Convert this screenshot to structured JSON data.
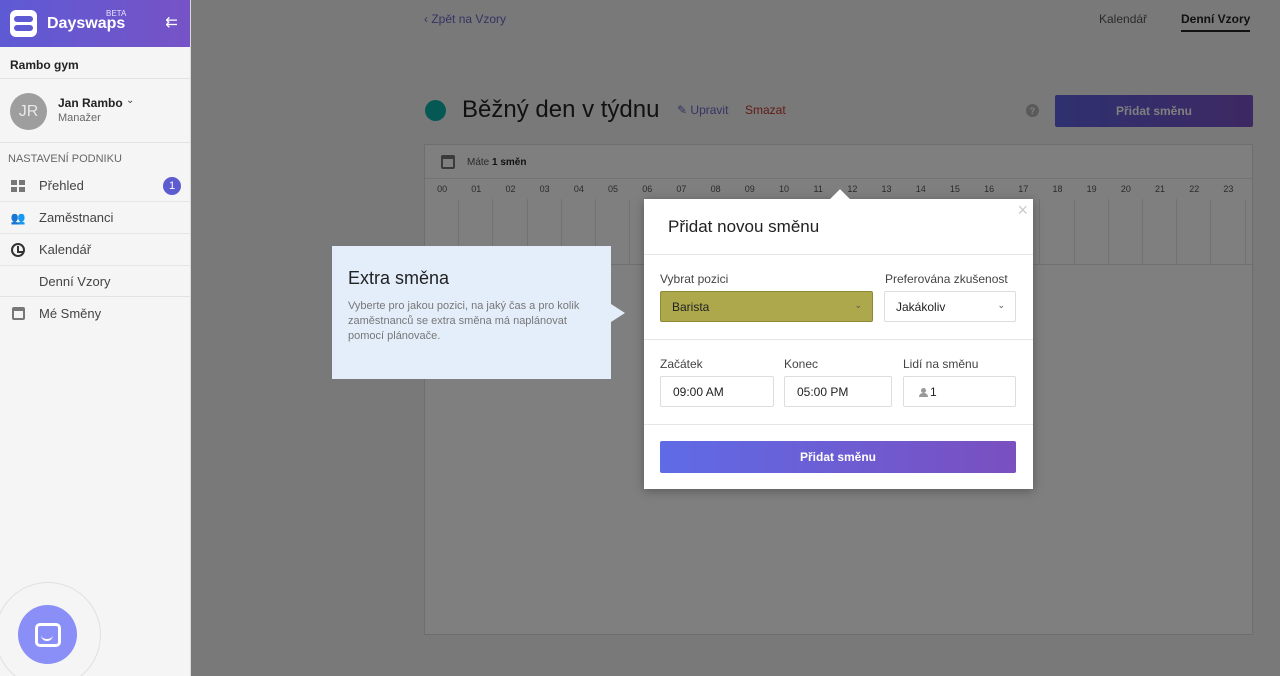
{
  "brand": {
    "name": "Dayswaps",
    "beta": "BETA",
    "collapse_icon": "collapse-icon"
  },
  "company": "Rambo gym",
  "user": {
    "initials": "JR",
    "name": "Jan Rambo",
    "role": "Manažer"
  },
  "sidebar": {
    "section_title": "NASTAVENÍ PODNIKU",
    "items": [
      {
        "label": "Přehled",
        "icon": "dashboard-icon",
        "badge": "1"
      },
      {
        "label": "Zaměstnanci",
        "icon": "users-icon"
      },
      {
        "label": "Kalendář",
        "icon": "clock-icon"
      },
      {
        "label": "Denní Vzory",
        "icon": ""
      },
      {
        "label": "Mé Směny",
        "icon": "calendar-icon"
      }
    ]
  },
  "topnav": {
    "back": "Zpět na Vzory",
    "tabs": [
      {
        "label": "Kalendář"
      },
      {
        "label": "Denní Vzory"
      }
    ]
  },
  "page": {
    "title": "Běžný den v týdnu",
    "edit": "Upravit",
    "delete": "Smazat",
    "add_shift": "Přidat směnu",
    "status_color": "#0ab1a8"
  },
  "schedule": {
    "count_prefix": "Máte",
    "count_value": "1 směn",
    "hours": [
      "00",
      "01",
      "02",
      "03",
      "04",
      "05",
      "06",
      "07",
      "08",
      "09",
      "10",
      "11",
      "12",
      "13",
      "14",
      "15",
      "16",
      "17",
      "18",
      "19",
      "20",
      "21",
      "22",
      "23"
    ]
  },
  "tooltip": {
    "title": "Extra směna",
    "text": "Vyberte pro jakou pozici, na jaký čas a pro kolik zaměstnanců se extra směna má naplánovat pomocí plánovače."
  },
  "modal": {
    "title": "Přidat novou směnu",
    "position_label": "Vybrat pozici",
    "position_value": "Barista",
    "experience_label": "Preferována zkušenost",
    "experience_value": "Jakákoliv",
    "start_label": "Začátek",
    "start_value": "09:00 AM",
    "end_label": "Konec",
    "end_value": "05:00 PM",
    "people_label": "Lidí na směnu",
    "people_value": "1",
    "submit": "Přidat směnu",
    "close": "×"
  },
  "colors": {
    "accent": "#5e5ad4",
    "position_highlight": "#ada84c",
    "danger": "#c0392b"
  }
}
